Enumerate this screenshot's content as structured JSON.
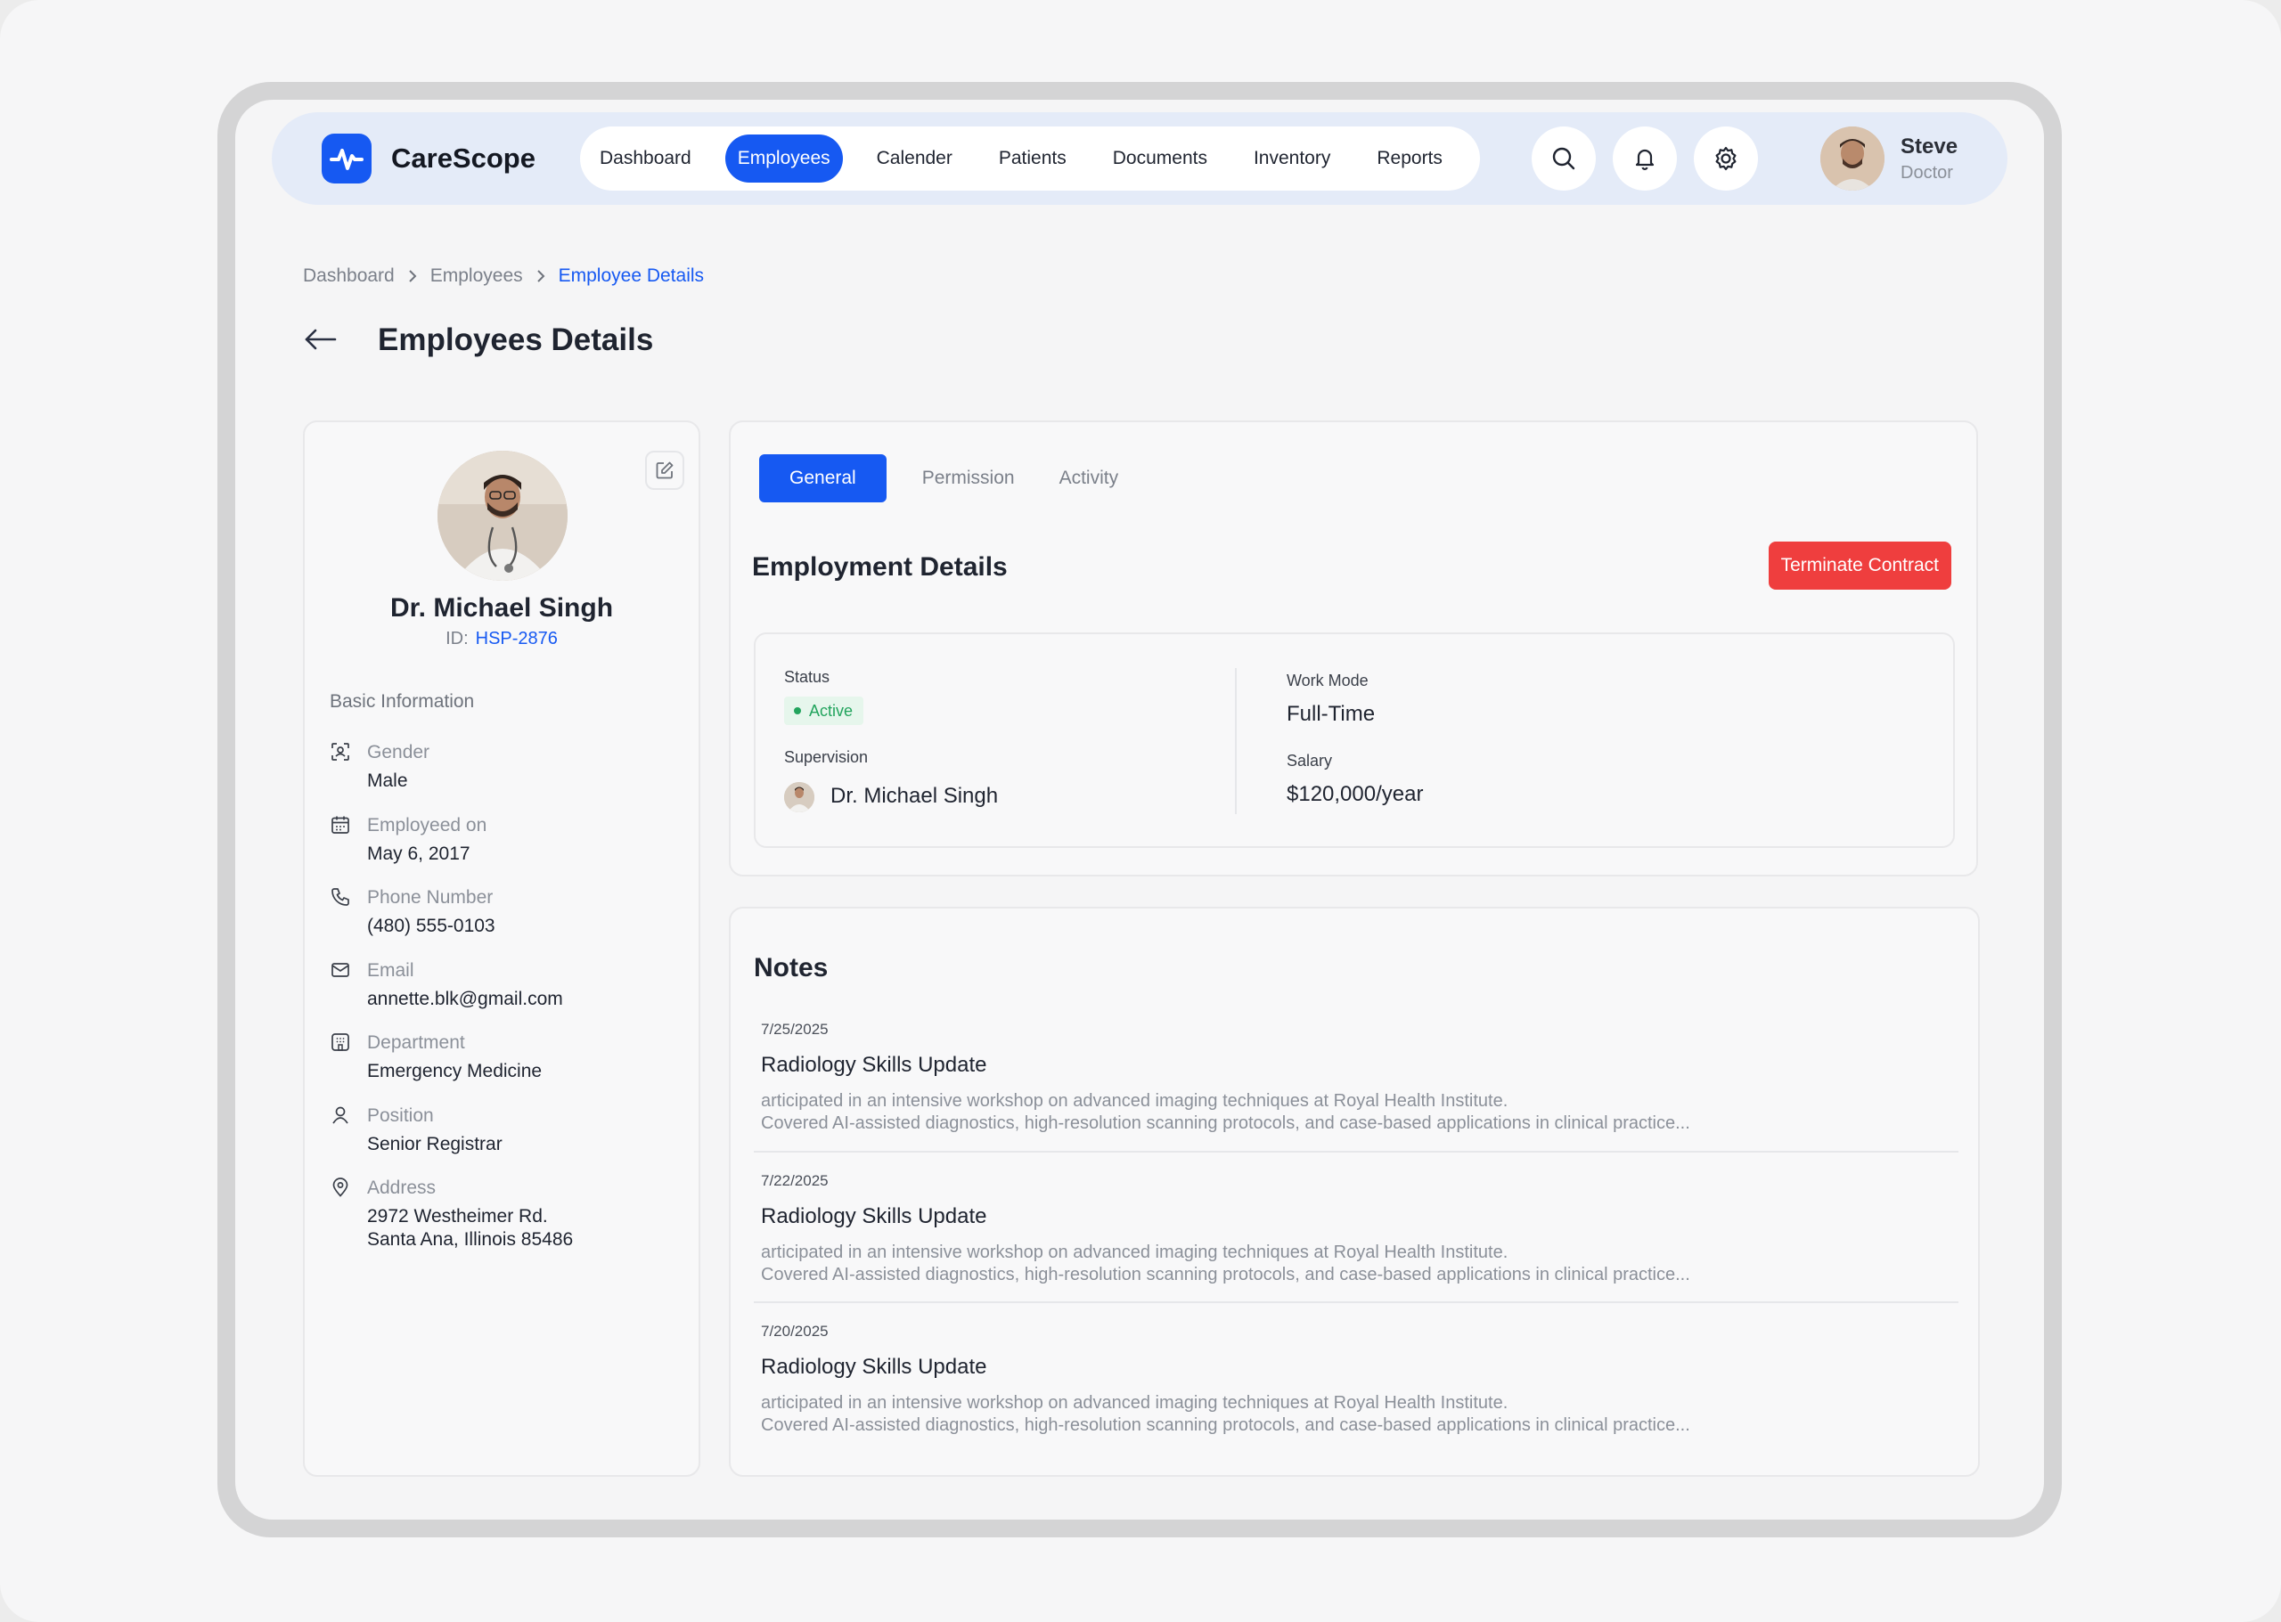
{
  "app": {
    "name": "CareScope",
    "brand_color": "#1659f2",
    "danger_color": "#ef3e3e",
    "success_color": "#22a45d"
  },
  "nav": {
    "items": [
      {
        "label": "Dashboard",
        "active": false
      },
      {
        "label": "Employees",
        "active": true
      },
      {
        "label": "Calender",
        "active": false
      },
      {
        "label": "Patients",
        "active": false
      },
      {
        "label": "Documents",
        "active": false
      },
      {
        "label": "Inventory",
        "active": false
      },
      {
        "label": "Reports",
        "active": false
      }
    ],
    "icons": [
      "search-icon",
      "bell-icon",
      "gear-icon"
    ]
  },
  "user": {
    "name": "Steve",
    "role": "Doctor"
  },
  "breadcrumb": [
    "Dashboard",
    "Employees",
    "Employee Details"
  ],
  "page": {
    "title": "Employees Details"
  },
  "profile": {
    "name": "Dr. Michael Singh",
    "id_label": "ID:",
    "id_value": "HSP-2876",
    "section_label": "Basic Information",
    "fields": [
      {
        "icon": "gender-icon",
        "label": "Gender",
        "value": "Male"
      },
      {
        "icon": "calendar-icon",
        "label": "Employeed on",
        "value": "May 6, 2017"
      },
      {
        "icon": "phone-icon",
        "label": "Phone Number",
        "value": "(480) 555-0103"
      },
      {
        "icon": "mail-icon",
        "label": "Email",
        "value": "annette.blk@gmail.com"
      },
      {
        "icon": "building-icon",
        "label": "Department",
        "value": "Emergency Medicine"
      },
      {
        "icon": "user-icon",
        "label": "Position",
        "value": "Senior Registrar"
      },
      {
        "icon": "location-icon",
        "label": "Address",
        "value": "2972 Westheimer Rd.",
        "value2": "Santa Ana, Illinois 85486"
      }
    ]
  },
  "tabs": [
    "General",
    "Permission",
    "Activity"
  ],
  "employment": {
    "title": "Employment Details",
    "terminate_label": "Terminate Contract",
    "status_label": "Status",
    "status_value": "Active",
    "supervision_label": "Supervision",
    "supervision_value": "Dr. Michael Singh",
    "work_mode_label": "Work Mode",
    "work_mode_value": "Full-Time",
    "salary_label": "Salary",
    "salary_value": "$120,000/year"
  },
  "notes": {
    "title": "Notes",
    "items": [
      {
        "date": "7/25/2025",
        "title": "Radiology Skills Update",
        "line1": "articipated in an intensive workshop on advanced imaging techniques at Royal Health Institute.",
        "line2": "Covered AI-assisted diagnostics, high-resolution scanning protocols, and case-based applications in clinical practice..."
      },
      {
        "date": "7/22/2025",
        "title": "Radiology Skills Update",
        "line1": "articipated in an intensive workshop on advanced imaging techniques at Royal Health Institute.",
        "line2": "Covered AI-assisted diagnostics, high-resolution scanning protocols, and case-based applications in clinical practice..."
      },
      {
        "date": "7/20/2025",
        "title": "Radiology Skills Update",
        "line1": "articipated in an intensive workshop on advanced imaging techniques at Royal Health Institute.",
        "line2": "Covered AI-assisted diagnostics, high-resolution scanning protocols, and case-based applications in clinical practice..."
      }
    ]
  }
}
